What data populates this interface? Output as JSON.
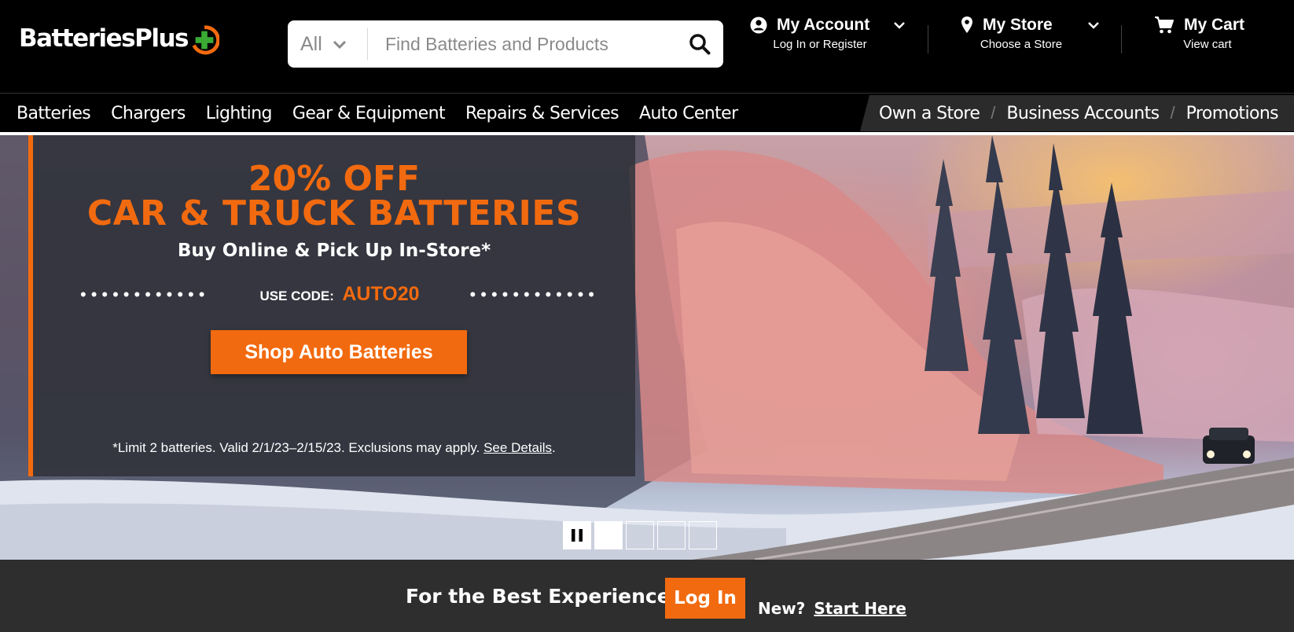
{
  "header": {
    "logo_text": "BatteriesPlus",
    "search": {
      "category": "All",
      "placeholder": "Find Batteries and Products"
    },
    "account": {
      "title": "My Account",
      "subtitle": "Log In or Register"
    },
    "store": {
      "title": "My Store",
      "subtitle": "Choose a Store"
    },
    "cart": {
      "title": "My Cart",
      "subtitle": "View cart"
    }
  },
  "nav": {
    "items": [
      "Batteries",
      "Chargers",
      "Lighting",
      "Gear & Equipment",
      "Repairs & Services",
      "Auto Center"
    ],
    "right_items": [
      "Own a Store",
      "Business Accounts",
      "Promotions"
    ]
  },
  "hero": {
    "headline_1": "20% OFF",
    "headline_2": "CAR & TRUCK BATTERIES",
    "subheadline": "Buy Online & Pick Up In-Store*",
    "code_label": "USE CODE:",
    "code_value": "AUTO20",
    "cta": "Shop Auto Batteries",
    "fine_print": "*Limit 2 batteries. Valid 2/1/23–2/15/23. Exclusions may apply.",
    "details_link": "See Details",
    "fine_print_end": ".",
    "carousel": {
      "slides": 4,
      "active_slide": 1
    }
  },
  "login_bar": {
    "title": "For the Best Experience",
    "login_button": "Log In",
    "new_label": "New?",
    "start_link": "Start Here"
  },
  "colors": {
    "accent": "#f26a0f",
    "header_bg": "#000000",
    "login_bar_bg": "#2e2e2e",
    "logo_plus": "#3aaa35"
  }
}
